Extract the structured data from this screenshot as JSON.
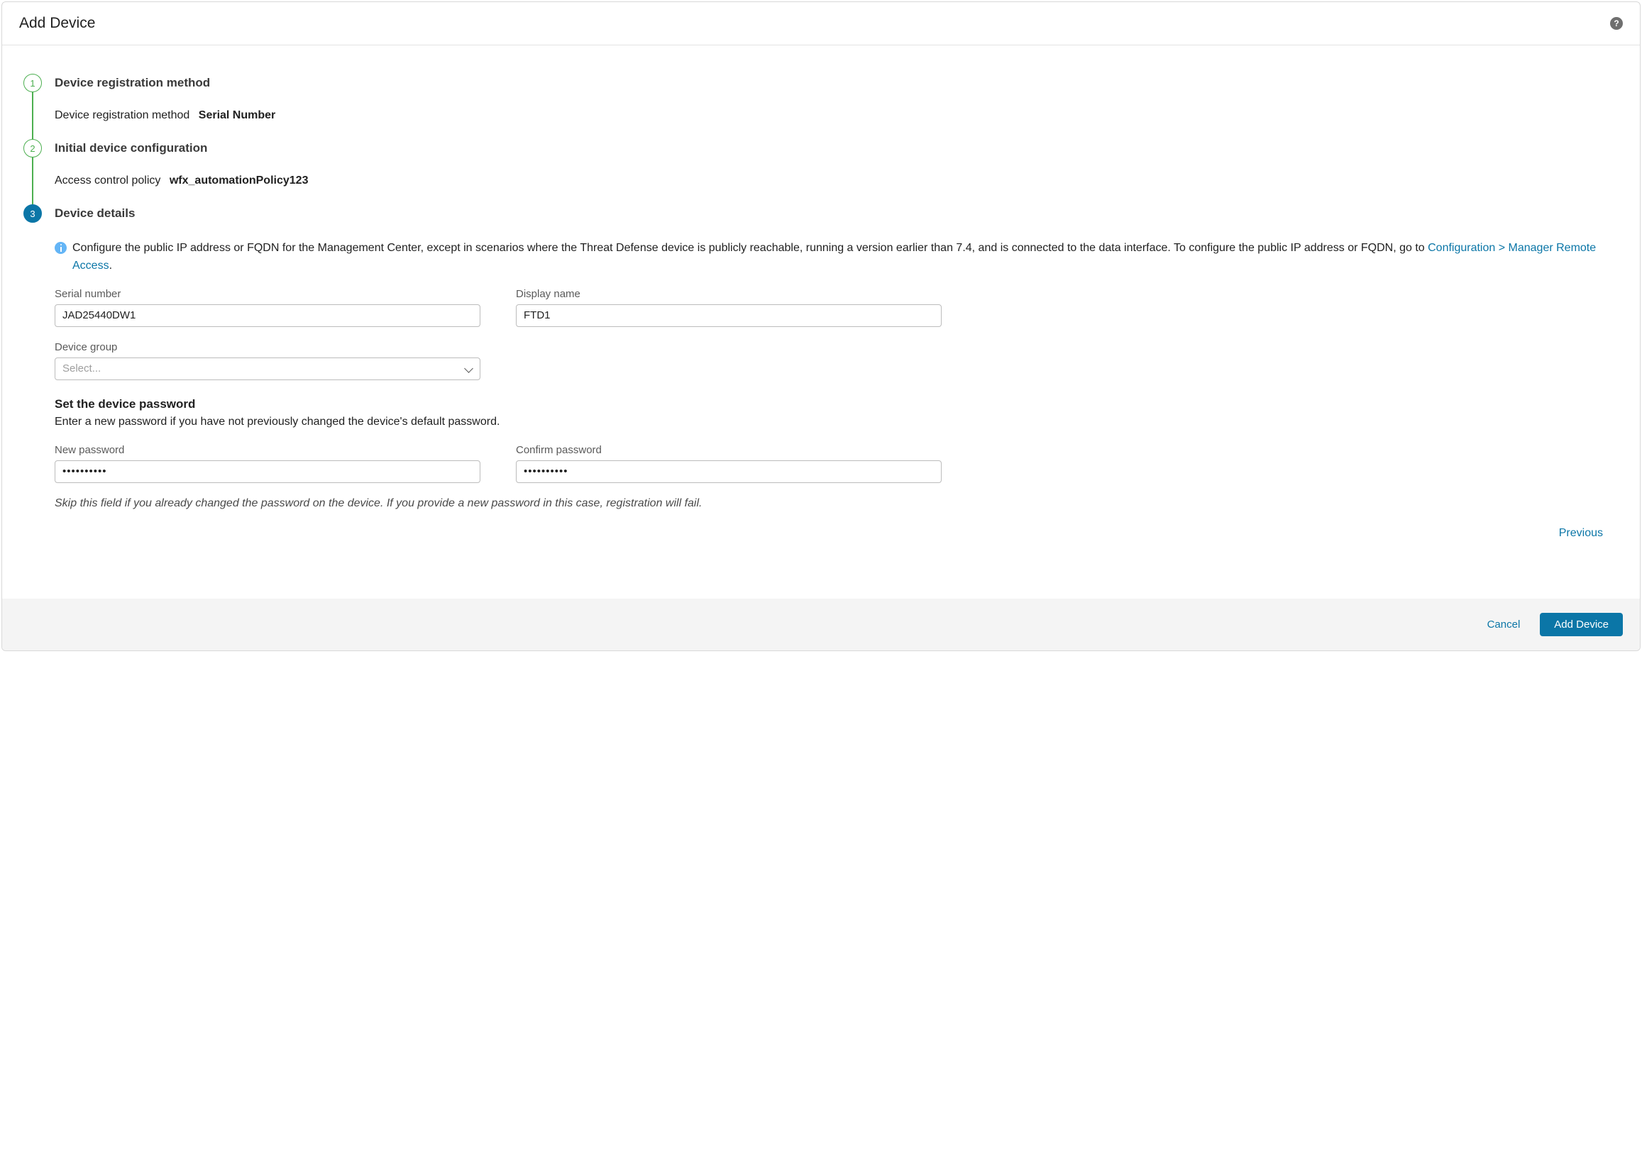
{
  "header": {
    "title": "Add Device"
  },
  "steps": {
    "s1": {
      "num": "1",
      "title": "Device registration method",
      "summary_label": "Device registration method",
      "summary_value": "Serial Number"
    },
    "s2": {
      "num": "2",
      "title": "Initial device configuration",
      "summary_label": "Access control policy",
      "summary_value": "wfx_automationPolicy123"
    },
    "s3": {
      "num": "3",
      "title": "Device details"
    }
  },
  "info": {
    "text_a": "Configure the public IP address or FQDN for the Management Center, except in scenarios where the Threat Defense device is publicly reachable, running a version earlier than 7.4, and is connected to the data interface. To configure the public IP address or FQDN, go to ",
    "link": "Configuration > Manager Remote Access",
    "text_b": "."
  },
  "form": {
    "serial_label": "Serial number",
    "serial_value": "JAD25440DW1",
    "display_label": "Display name",
    "display_value": "FTD1",
    "group_label": "Device group",
    "group_placeholder": "Select...",
    "pw_heading": "Set the device password",
    "pw_desc": "Enter a new password if you have not previously changed the device's default password.",
    "newpw_label": "New password",
    "confirmpw_label": "Confirm password",
    "pw_value": "••••••••••",
    "skip_note": "Skip this field if you already changed the password on the device. If you provide a new password in this case, registration will fail."
  },
  "actions": {
    "previous": "Previous",
    "cancel": "Cancel",
    "add": "Add Device"
  }
}
